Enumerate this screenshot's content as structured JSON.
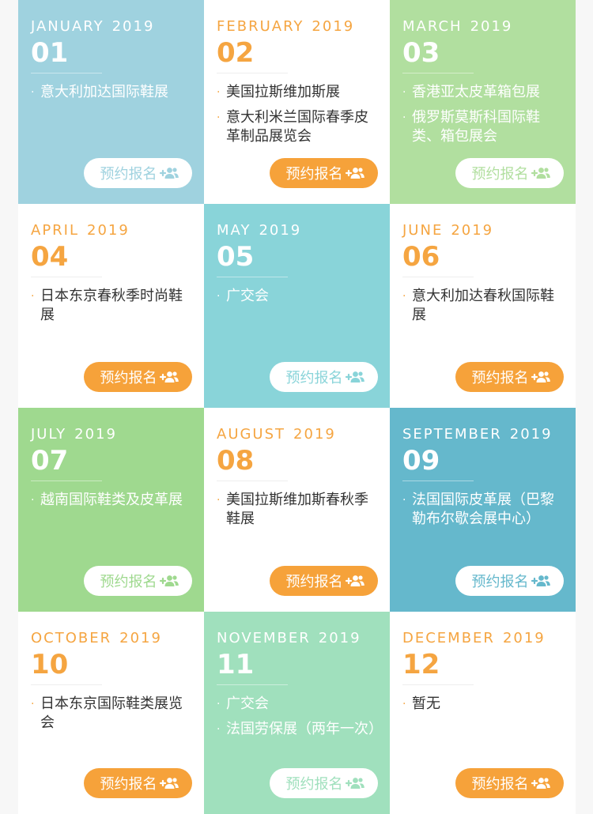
{
  "button_label": "预约报名",
  "add_user_icon": "add-user-icon",
  "colors": {
    "orange": "#f6a23a",
    "blue": "#9fd2df",
    "green": "#b1df9f",
    "teal": "#89d4d9",
    "green2": "#9fd98f",
    "steel": "#65b8cc",
    "mint": "#a0e0bd"
  },
  "months": [
    {
      "name": "JANUARY",
      "year": "2019",
      "num": "01",
      "bg": "#9fd2df",
      "events": [
        "意大利加达国际鞋展"
      ]
    },
    {
      "name": "FEBRUARY",
      "year": "2019",
      "num": "02",
      "bg": "#ffffff",
      "events": [
        "美国拉斯维加斯展",
        "意大利米兰国际春季皮革制品展览会"
      ]
    },
    {
      "name": "MARCH",
      "year": "2019",
      "num": "03",
      "bg": "#b1df9f",
      "events": [
        "香港亚太皮革箱包展",
        "俄罗斯莫斯科国际鞋类、箱包展会"
      ]
    },
    {
      "name": "APRIL",
      "year": "2019",
      "num": "04",
      "bg": "#ffffff",
      "events": [
        "日本东京春秋季时尚鞋展"
      ]
    },
    {
      "name": "MAY",
      "year": "2019",
      "num": "05",
      "bg": "#89d4d9",
      "events": [
        "广交会"
      ]
    },
    {
      "name": "JUNE",
      "year": "2019",
      "num": "06",
      "bg": "#ffffff",
      "events": [
        "意大利加达春秋国际鞋展"
      ]
    },
    {
      "name": "JULY",
      "year": "2019",
      "num": "07",
      "bg": "#9fd98f",
      "events": [
        "越南国际鞋类及皮革展"
      ]
    },
    {
      "name": "AUGUST",
      "year": "2019",
      "num": "08",
      "bg": "#ffffff",
      "events": [
        "美国拉斯维加斯春秋季鞋展"
      ]
    },
    {
      "name": "SEPTEMBER",
      "year": "2019",
      "num": "09",
      "bg": "#65b8cc",
      "events": [
        "法国国际皮革展（巴黎勒布尔歇会展中心）"
      ]
    },
    {
      "name": "OCTOBER",
      "year": "2019",
      "num": "10",
      "bg": "#ffffff",
      "events": [
        "日本东京国际鞋类展览会"
      ]
    },
    {
      "name": "NOVEMBER",
      "year": "2019",
      "num": "11",
      "bg": "#a0e0bd",
      "events": [
        "广交会",
        "法国劳保展（两年一次）"
      ]
    },
    {
      "name": "DECEMBER",
      "year": "2019",
      "num": "12",
      "bg": "#ffffff",
      "events": [
        "暂无"
      ]
    }
  ]
}
